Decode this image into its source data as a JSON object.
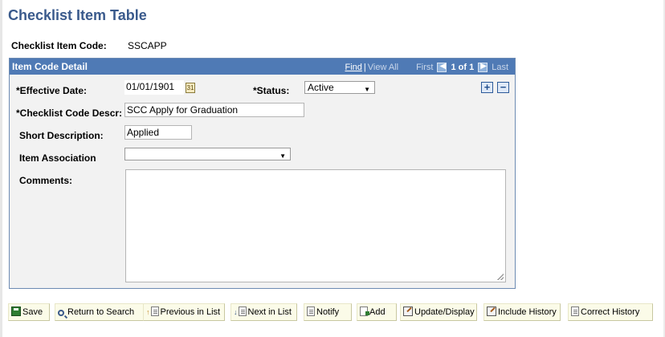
{
  "page": {
    "title": "Checklist Item Table",
    "checklist_item_code_label": "Checklist Item Code:",
    "checklist_item_code_value": "SSCAPP"
  },
  "detail": {
    "title": "Item Code Detail",
    "nav": {
      "find": "Find",
      "separator": "|",
      "view_all": "View All",
      "first": "First",
      "count": "1 of 1",
      "last": "Last"
    },
    "fields": {
      "effective_date_label": "*Effective Date:",
      "effective_date_value": "01/01/1901",
      "status_label": "*Status:",
      "status_value": "Active",
      "checklist_code_descr_label": "*Checklist Code Descr:",
      "checklist_code_descr_value": "SCC Apply for Graduation",
      "short_description_label": "Short Description:",
      "short_description_value": "Applied",
      "item_association_label": "Item Association",
      "item_association_value": "",
      "comments_label": "Comments:",
      "comments_value": ""
    },
    "row_buttons": {
      "add": "+",
      "delete": "−"
    }
  },
  "toolbar": {
    "save": "Save",
    "return_to_search": "Return to Search",
    "previous_in_list": "Previous in List",
    "next_in_list": "Next in List",
    "notify": "Notify",
    "add": "Add",
    "update_display": "Update/Display",
    "include_history": "Include History",
    "correct_history": "Correct History"
  },
  "icons": {
    "calendar": "calendar-icon",
    "dropdown": "chevron-down-icon",
    "first": "arrow-left-icon",
    "last": "arrow-right-icon"
  },
  "colors": {
    "title": "#3a5a8c",
    "header_bg": "#4f7ab5",
    "panel_bg": "#f2f2f2",
    "button_bg": "#fbfbe8"
  }
}
